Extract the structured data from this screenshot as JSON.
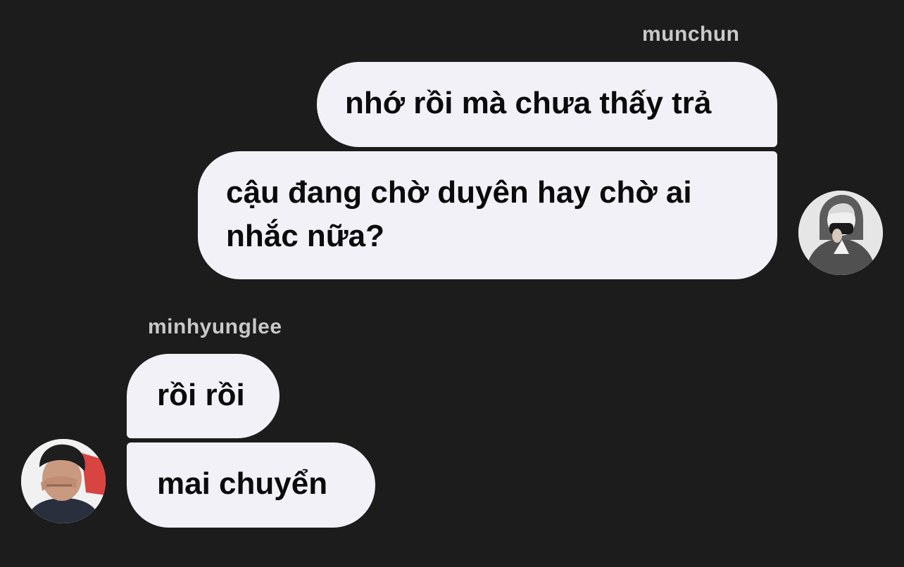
{
  "conversation": {
    "messages": [
      {
        "sender": "munchun",
        "side": "right",
        "avatar_icon": "user-avatar-munchun-icon",
        "lines": [
          "nhớ rồi mà chưa thấy trả"
        ]
      },
      {
        "sender": "munchun",
        "side": "right",
        "lines": [
          "cậu đang chờ duyên hay chờ ai",
          "nhắc nữa?"
        ]
      },
      {
        "sender": "minhyunglee",
        "side": "left",
        "lines": [
          "rồi rồi"
        ]
      },
      {
        "sender": "minhyunglee",
        "side": "left",
        "avatar_icon": "user-avatar-minhyunglee-icon",
        "lines": [
          "mai chuyển"
        ]
      }
    ],
    "senders": {
      "munchun": "munchun",
      "minhyunglee": "minhyunglee"
    }
  },
  "colors": {
    "background": "#1c1c1c",
    "bubble": "#f2f1f7",
    "bubble_text": "#0b0b0b",
    "sender_name": "#c9c9c9"
  }
}
